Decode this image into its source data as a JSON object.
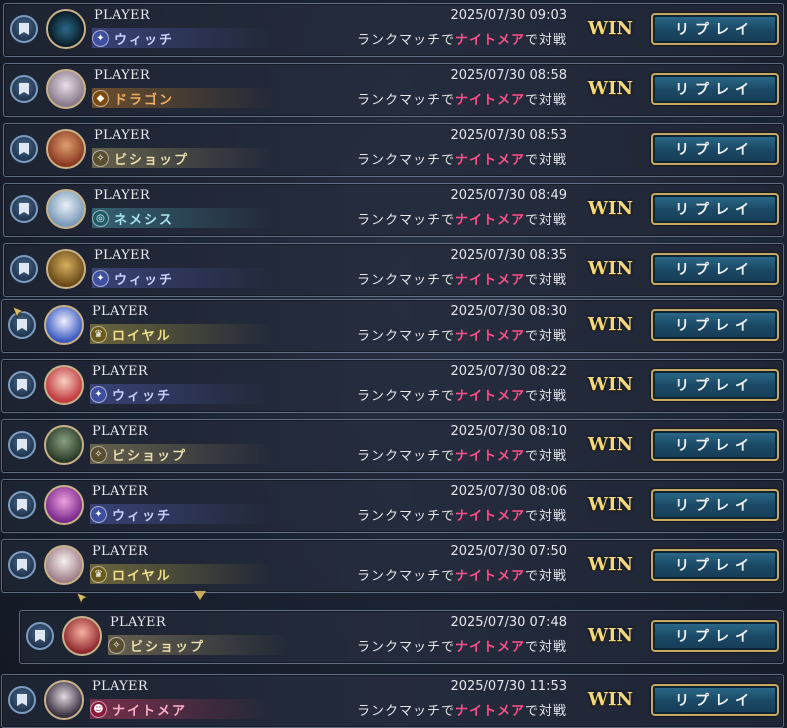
{
  "rows": [
    {
      "player": "PLAYER",
      "cls": "ウィッチ",
      "date": "2025/07/30 09:03",
      "pre": "ランクマッチで",
      "hl": "ナイトメア",
      "post": "で対戦",
      "result": "WIN",
      "replay": "リプレイ"
    },
    {
      "player": "PLAYER",
      "cls": "ドラゴン",
      "date": "2025/07/30 08:58",
      "pre": "ランクマッチで",
      "hl": "ナイトメア",
      "post": "で対戦",
      "result": "WIN",
      "replay": "リプレイ"
    },
    {
      "player": "PLAYER",
      "cls": "ビショップ",
      "date": "2025/07/30 08:53",
      "pre": "ランクマッチで",
      "hl": "ナイトメア",
      "post": "で対戦",
      "result": "",
      "replay": "リプレイ"
    },
    {
      "player": "PLAYER",
      "cls": "ネメシス",
      "date": "2025/07/30 08:49",
      "pre": "ランクマッチで",
      "hl": "ナイトメア",
      "post": "で対戦",
      "result": "WIN",
      "replay": "リプレイ"
    },
    {
      "player": "PLAYER",
      "cls": "ウィッチ",
      "date": "2025/07/30 08:35",
      "pre": "ランクマッチで",
      "hl": "ナイトメア",
      "post": "で対戦",
      "result": "WIN",
      "replay": "リプレイ"
    },
    {
      "player": "PLAYER",
      "cls": "ロイヤル",
      "date": "2025/07/30 08:30",
      "pre": "ランクマッチで",
      "hl": "ナイトメア",
      "post": "で対戦",
      "result": "WIN",
      "replay": "リプレイ"
    },
    {
      "player": "PLAYER",
      "cls": "ウィッチ",
      "date": "2025/07/30 08:22",
      "pre": "ランクマッチで",
      "hl": "ナイトメア",
      "post": "で対戦",
      "result": "WIN",
      "replay": "リプレイ"
    },
    {
      "player": "PLAYER",
      "cls": "ビショップ",
      "date": "2025/07/30 08:10",
      "pre": "ランクマッチで",
      "hl": "ナイトメア",
      "post": "で対戦",
      "result": "WIN",
      "replay": "リプレイ"
    },
    {
      "player": "PLAYER",
      "cls": "ウィッチ",
      "date": "2025/07/30 08:06",
      "pre": "ランクマッチで",
      "hl": "ナイトメア",
      "post": "で対戦",
      "result": "WIN",
      "replay": "リプレイ"
    },
    {
      "player": "PLAYER",
      "cls": "ロイヤル",
      "date": "2025/07/30 07:50",
      "pre": "ランクマッチで",
      "hl": "ナイトメア",
      "post": "で対戦",
      "result": "WIN",
      "replay": "リプレイ"
    },
    {
      "player": "PLAYER",
      "cls": "ビショップ",
      "date": "2025/07/30 07:48",
      "pre": "ランクマッチで",
      "hl": "ナイトメア",
      "post": "で対戦",
      "result": "WIN",
      "replay": "リプレイ"
    },
    {
      "player": "PLAYER",
      "cls": "ナイトメア",
      "date": "2025/07/30 11:53",
      "pre": "ランクマッチで",
      "hl": "ナイトメア",
      "post": "で対戦",
      "result": "WIN",
      "replay": "リプレイ"
    }
  ],
  "class_colors": {
    "witch": "#7a88e0",
    "dragon": "#d79a3c",
    "bishop": "#c9b98a",
    "nemesis": "#6fc0d0",
    "royal": "#d8c45a",
    "nightmare": "#e04a6a"
  }
}
